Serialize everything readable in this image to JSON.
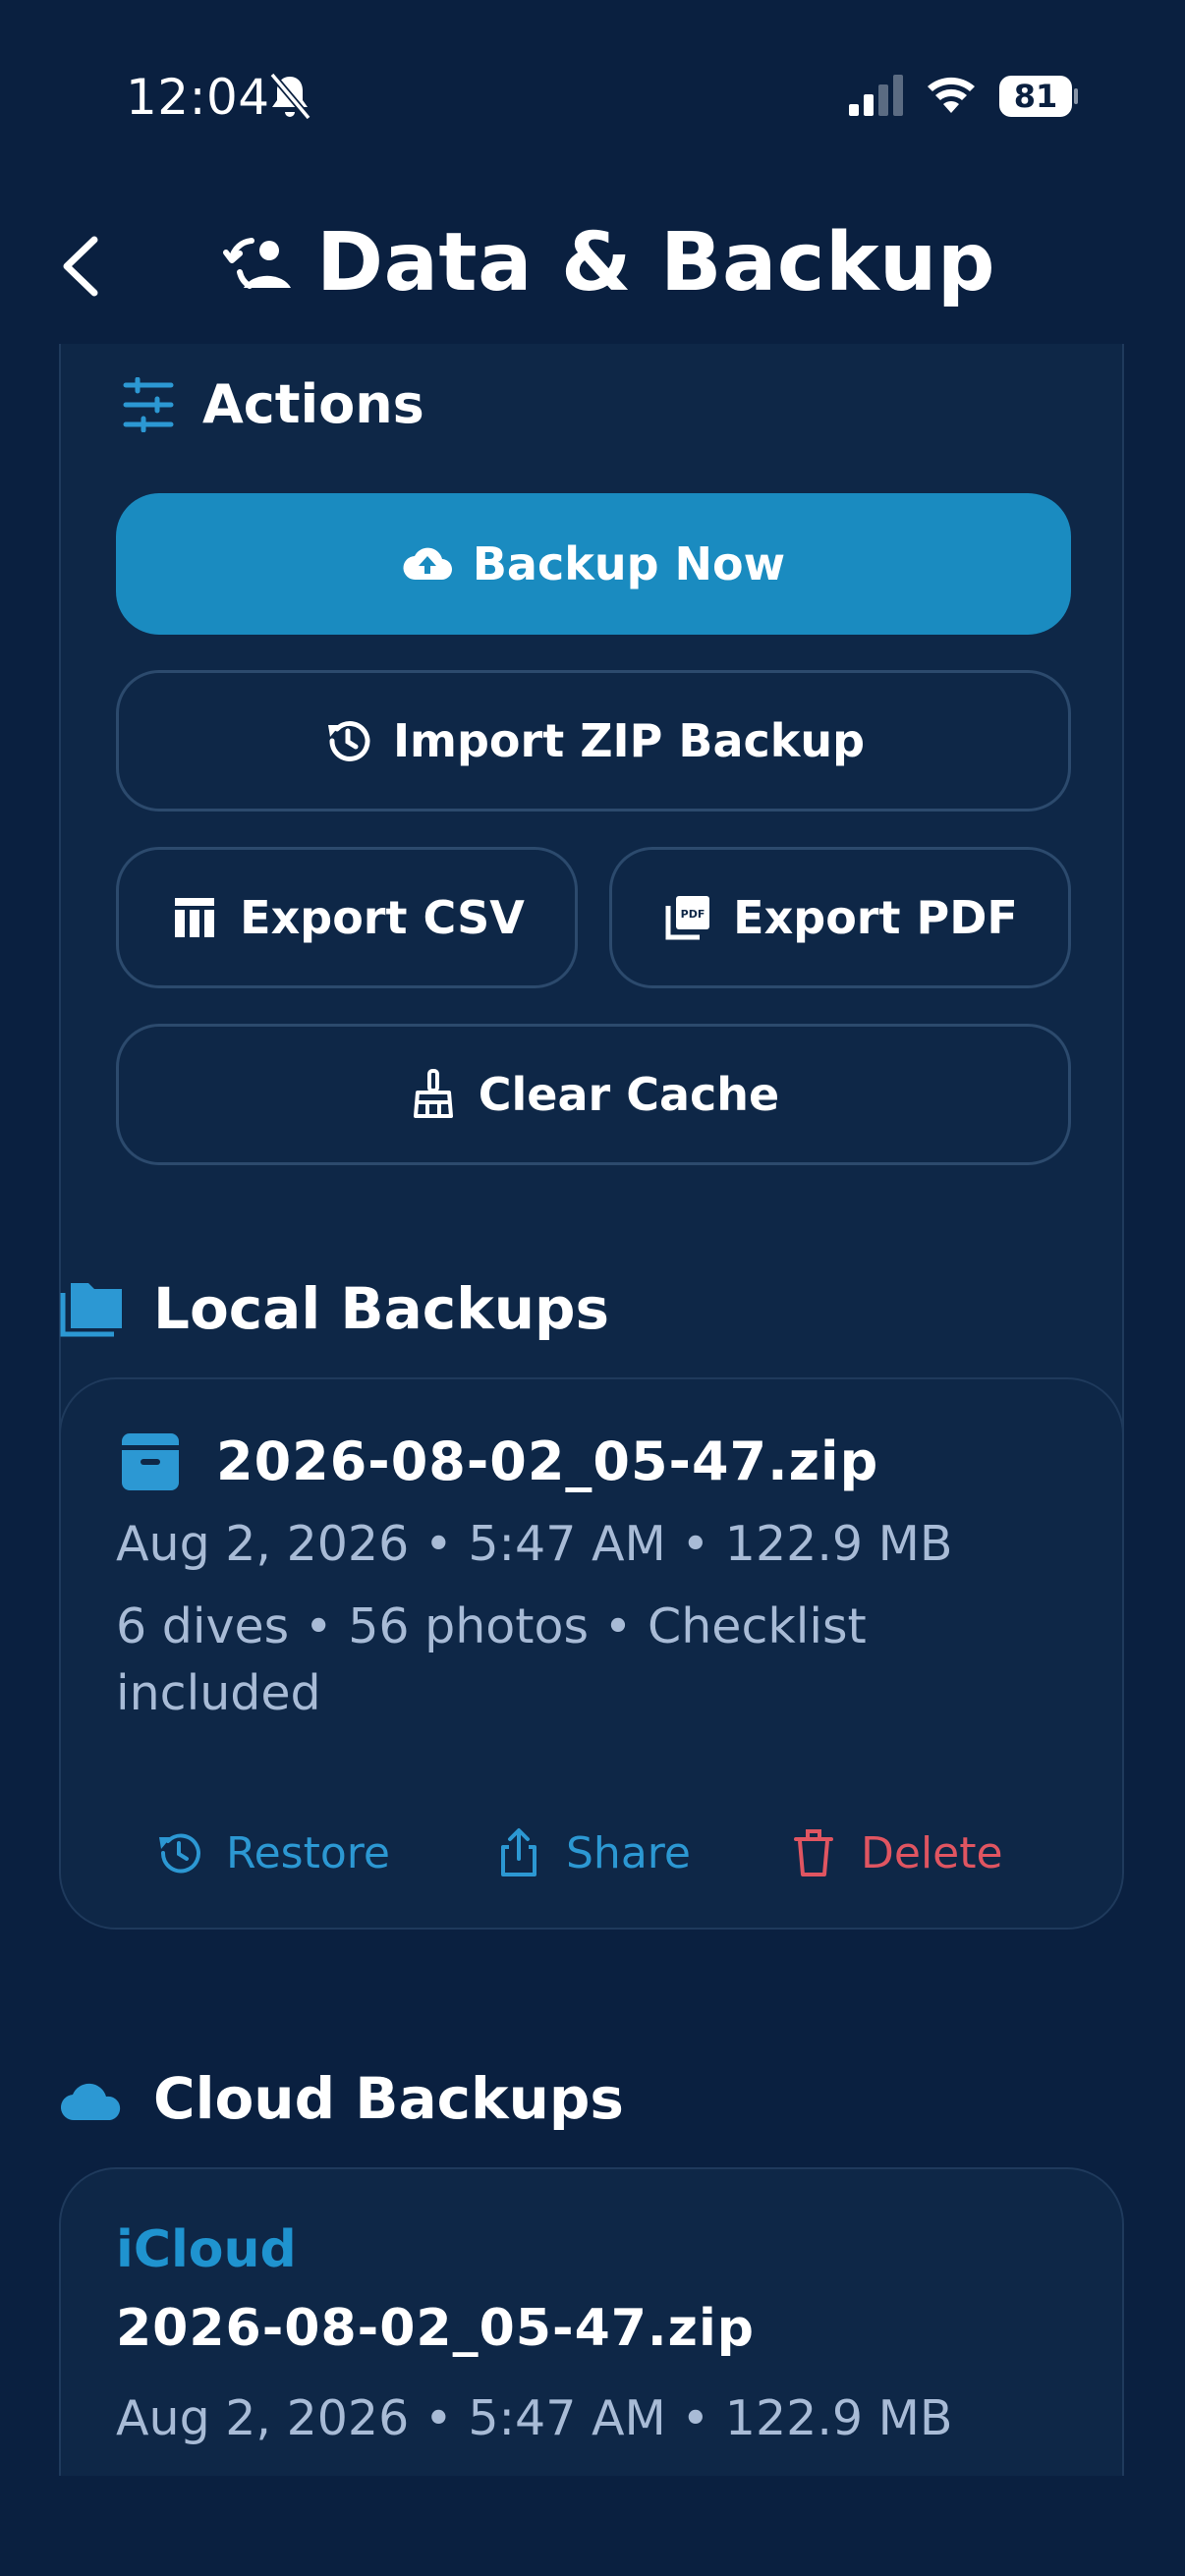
{
  "status": {
    "time": "12:04",
    "battery": "81",
    "icons": [
      "bell-slash-icon",
      "signal-icon",
      "wifi-icon",
      "battery-icon"
    ]
  },
  "header": {
    "title": "Data & Backup",
    "back_icon": "chevron-left-icon",
    "title_icon": "backup-sync-icon"
  },
  "actions": {
    "heading": "Actions",
    "backup_now": "Backup Now",
    "import_zip": "Import ZIP Backup",
    "export_csv": "Export CSV",
    "export_pdf": "Export PDF",
    "clear_cache": "Clear Cache"
  },
  "local": {
    "heading": "Local Backups",
    "items": [
      {
        "file": "2026-08-02_05-47.zip",
        "meta": "Aug 2, 2026 • 5:47 AM • 122.9 MB",
        "details": "6 dives • 56 photos • Checklist included",
        "restore": "Restore",
        "share": "Share",
        "delete": "Delete"
      }
    ]
  },
  "cloud": {
    "heading": "Cloud Backups",
    "items": [
      {
        "provider": "iCloud",
        "file": "2026-08-02_05-47.zip",
        "meta": "Aug 2, 2026 • 5:47 AM • 122.9 MB"
      }
    ]
  },
  "colors": {
    "background": "#0a2040",
    "card": "#0e2747",
    "accent": "#1a8bc0",
    "link": "#2c98d3",
    "danger": "#e05561",
    "muted": "#a8bbd6"
  }
}
